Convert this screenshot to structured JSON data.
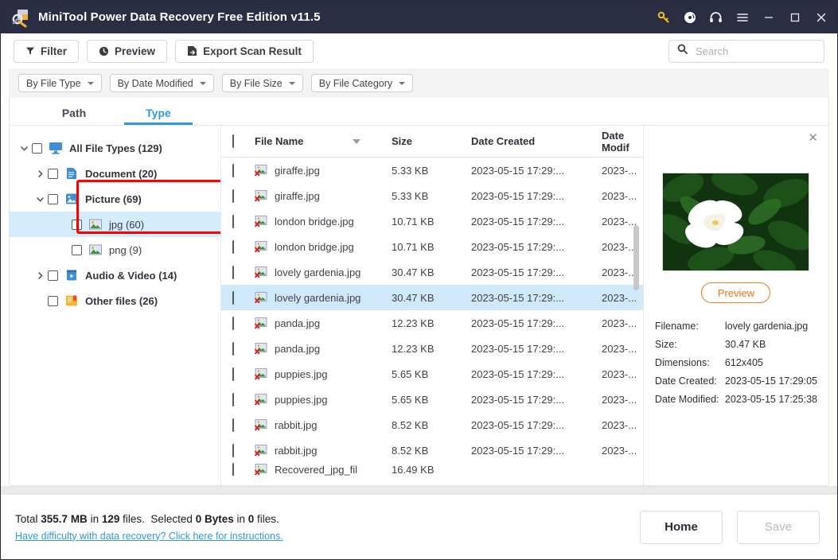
{
  "window": {
    "title": "MiniTool Power Data Recovery Free Edition v11.5",
    "logo_icon": "minitool-logo-icon",
    "controls": [
      {
        "name": "key-icon",
        "glyph": "key"
      },
      {
        "name": "disc-icon",
        "glyph": "disc"
      },
      {
        "name": "headphones-icon",
        "glyph": "headphones"
      },
      {
        "name": "menu-icon",
        "glyph": "hamburger"
      },
      {
        "name": "minimize-icon",
        "glyph": "minimize"
      },
      {
        "name": "maximize-icon",
        "glyph": "maximize"
      },
      {
        "name": "close-icon",
        "glyph": "close"
      }
    ]
  },
  "toolbar": {
    "filter_label": "Filter",
    "preview_label": "Preview",
    "export_label": "Export Scan Result"
  },
  "search": {
    "placeholder": "Search",
    "value": "",
    "icon": "search-icon"
  },
  "chips": [
    {
      "label": "By File Type"
    },
    {
      "label": "By Date Modified"
    },
    {
      "label": "By File Size"
    },
    {
      "label": "By File Category"
    }
  ],
  "tabs": [
    {
      "label": "Path",
      "active": false
    },
    {
      "label": "Type",
      "active": true
    }
  ],
  "tree": [
    {
      "label": "All File Types (129)",
      "icon": "monitor-icon",
      "indent": 0,
      "arrow": "down",
      "checkbox": true,
      "selected": false
    },
    {
      "label": "Document (20)",
      "icon": "document-icon",
      "indent": 1,
      "arrow": "right",
      "checkbox": true,
      "selected": false
    },
    {
      "label": "Picture (69)",
      "icon": "picture-icon",
      "indent": 1,
      "arrow": "down",
      "checkbox": true,
      "selected": false
    },
    {
      "label": "jpg (60)",
      "icon": "image-file-icon",
      "indent": 2,
      "arrow": "none",
      "checkbox": true,
      "selected": true
    },
    {
      "label": "png (9)",
      "icon": "image-file-icon",
      "indent": 2,
      "arrow": "none",
      "checkbox": true,
      "selected": false
    },
    {
      "label": "Audio & Video (14)",
      "icon": "video-icon",
      "indent": 1,
      "arrow": "right",
      "checkbox": true,
      "selected": false
    },
    {
      "label": "Other files (26)",
      "icon": "other-files-icon",
      "indent": 1,
      "arrow": "none",
      "checkbox": true,
      "selected": false
    }
  ],
  "table": {
    "columns": {
      "file_name": "File Name",
      "size": "Size",
      "date_created": "Date Created",
      "date_modified": "Date Modif"
    },
    "sort_icon": "sort-descending-icon",
    "rows": [
      {
        "name": "giraffe.jpg",
        "size": "5.33 KB",
        "created": "2023-05-15 17:29:...",
        "modified": "2023-...",
        "selected": false
      },
      {
        "name": "giraffe.jpg",
        "size": "5.33 KB",
        "created": "2023-05-15 17:29:...",
        "modified": "2023-...",
        "selected": false
      },
      {
        "name": "london bridge.jpg",
        "size": "10.71 KB",
        "created": "2023-05-15 17:29:...",
        "modified": "2023-...",
        "selected": false
      },
      {
        "name": "london bridge.jpg",
        "size": "10.71 KB",
        "created": "2023-05-15 17:29:...",
        "modified": "2023-...",
        "selected": false
      },
      {
        "name": "lovely gardenia.jpg",
        "size": "30.47 KB",
        "created": "2023-05-15 17:29:...",
        "modified": "2023-...",
        "selected": false
      },
      {
        "name": "lovely gardenia.jpg",
        "size": "30.47 KB",
        "created": "2023-05-15 17:29:...",
        "modified": "2023-...",
        "selected": true
      },
      {
        "name": "panda.jpg",
        "size": "12.23 KB",
        "created": "2023-05-15 17:29:...",
        "modified": "2023-...",
        "selected": false
      },
      {
        "name": "panda.jpg",
        "size": "12.23 KB",
        "created": "2023-05-15 17:29:...",
        "modified": "2023-...",
        "selected": false
      },
      {
        "name": "puppies.jpg",
        "size": "5.65 KB",
        "created": "2023-05-15 17:29:...",
        "modified": "2023-...",
        "selected": false
      },
      {
        "name": "puppies.jpg",
        "size": "5.65 KB",
        "created": "2023-05-15 17:29:...",
        "modified": "2023-...",
        "selected": false
      },
      {
        "name": "rabbit.jpg",
        "size": "8.52 KB",
        "created": "2023-05-15 17:29:...",
        "modified": "2023-...",
        "selected": false
      },
      {
        "name": "rabbit.jpg",
        "size": "8.52 KB",
        "created": "2023-05-15 17:29:...",
        "modified": "2023-...",
        "selected": false
      },
      {
        "name": "Recovered_jpg_fil",
        "size": "16.49 KB",
        "created": "",
        "modified": "",
        "selected": false
      }
    ]
  },
  "preview": {
    "close_icon": "close-icon",
    "image_alt": "white gardenia flower on green leaves",
    "button_label": "Preview",
    "details": [
      {
        "key": "Filename:",
        "value": "lovely gardenia.jpg"
      },
      {
        "key": "Size:",
        "value": "30.47 KB"
      },
      {
        "key": "Dimensions:",
        "value": "612x405"
      },
      {
        "key": "Date Created:",
        "value": "2023-05-15 17:29:05"
      },
      {
        "key": "Date Modified:",
        "value": "2023-05-15 17:25:38"
      }
    ]
  },
  "footer": {
    "total_prefix": "Total ",
    "total_size": "355.7 MB",
    "total_mid": " in ",
    "total_count": "129",
    "total_suffix": " files.",
    "selected_prefix": "Selected ",
    "selected_size": "0 Bytes",
    "selected_mid": " in ",
    "selected_count": "0",
    "selected_suffix": " files.",
    "help_link": "Have difficulty with data recovery? Click here for instructions.",
    "home_label": "Home",
    "save_label": "Save"
  },
  "colors": {
    "titlebar": "#2b2d42",
    "accent_blue": "#2f9ae0",
    "selection_blue": "#cfe9fb",
    "highlight_red": "#fd0000",
    "preview_orange": "#e8791c"
  }
}
